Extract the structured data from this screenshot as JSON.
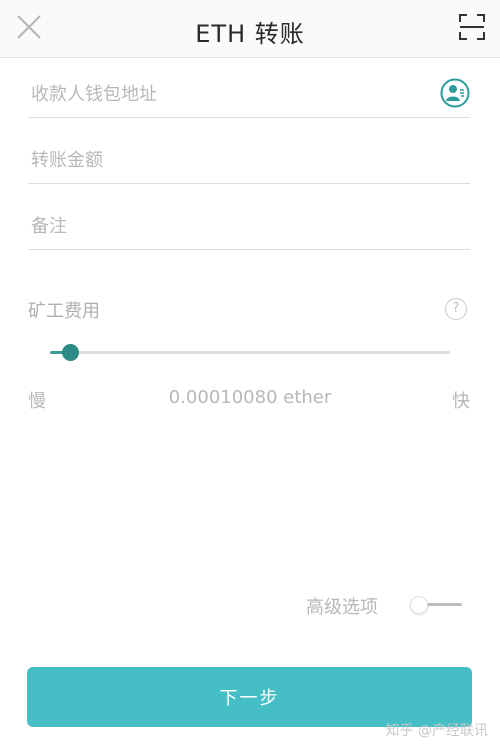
{
  "header": {
    "title": "ETH 转账",
    "close_icon": "close-icon",
    "scan_icon": "scan-icon"
  },
  "form": {
    "address_placeholder": "收款人钱包地址",
    "amount_placeholder": "转账金额",
    "memo_placeholder": "备注",
    "contact_icon": "contact-book-icon"
  },
  "fee": {
    "label": "矿工费用",
    "help_icon_text": "?",
    "slow_label": "慢",
    "fast_label": "快",
    "value_text": "0.00010080 ether",
    "slider_position": 0.03
  },
  "advanced": {
    "label": "高级选项",
    "enabled": false
  },
  "next_button_label": "下一步",
  "watermark": "知乎 @产经联讯",
  "colors": {
    "accent": "#45bec6",
    "slider": "#2e8a84",
    "contact_icon": "#2e9c9a"
  }
}
